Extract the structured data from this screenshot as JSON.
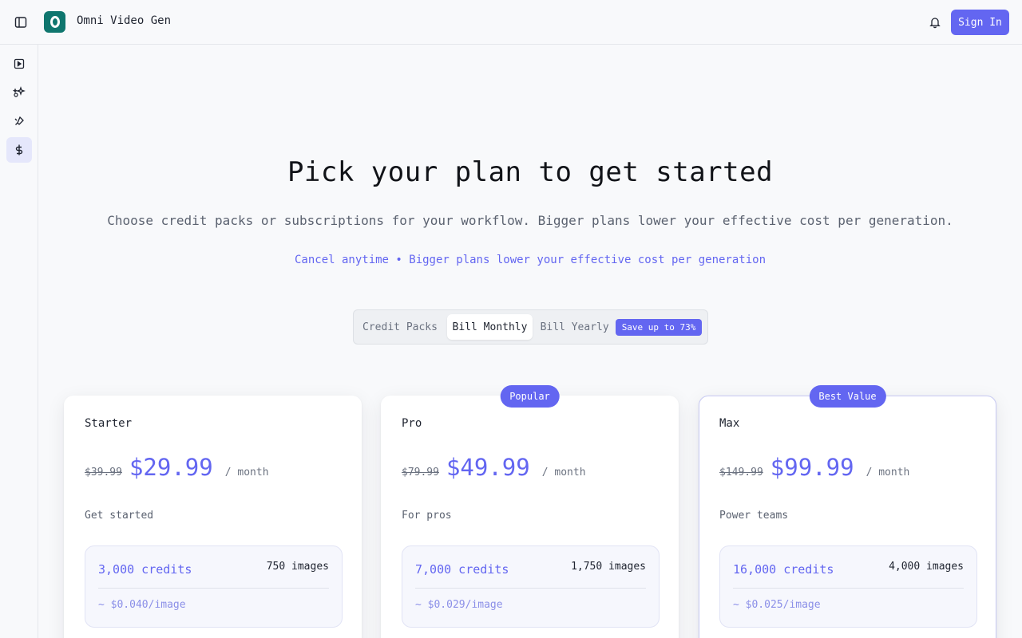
{
  "header": {
    "app_title": "Omni Video Gen",
    "sign_in_label": "Sign In"
  },
  "sidebar": {
    "items": [
      {
        "icon": "video-play-icon"
      },
      {
        "icon": "sparkles-icon"
      },
      {
        "icon": "brush-icon"
      },
      {
        "icon": "dollar-icon",
        "active": true
      }
    ]
  },
  "hero": {
    "title": "Pick your plan to get started",
    "subtitle": "Choose credit packs or subscriptions for your workflow. Bigger plans lower your effective cost per generation.",
    "tagline": "Cancel anytime • Bigger plans lower your effective cost per generation"
  },
  "billing_toggle": {
    "options": [
      "Credit Packs",
      "Bill Monthly",
      "Bill Yearly"
    ],
    "selected": "Bill Monthly",
    "save_badge": "Save up to 73%"
  },
  "plans": [
    {
      "name": "Starter",
      "old_price": "$39.99",
      "price": "$29.99",
      "period": "/ month",
      "description": "Get started",
      "credits": "3,000 credits",
      "images": "750 images",
      "per_image": "~ $0.040/image",
      "badge": ""
    },
    {
      "name": "Pro",
      "old_price": "$79.99",
      "price": "$49.99",
      "period": "/ month",
      "description": "For pros",
      "credits": "7,000 credits",
      "images": "1,750 images",
      "per_image": "~ $0.029/image",
      "badge": "Popular"
    },
    {
      "name": "Max",
      "old_price": "$149.99",
      "price": "$99.99",
      "period": "/ month",
      "description": "Power teams",
      "credits": "16,000 credits",
      "images": "4,000 images",
      "per_image": "~ $0.025/image",
      "badge": "Best Value"
    }
  ],
  "colors": {
    "accent": "#6366f1",
    "logo": "#0f766e",
    "background": "#f8f9fb"
  }
}
